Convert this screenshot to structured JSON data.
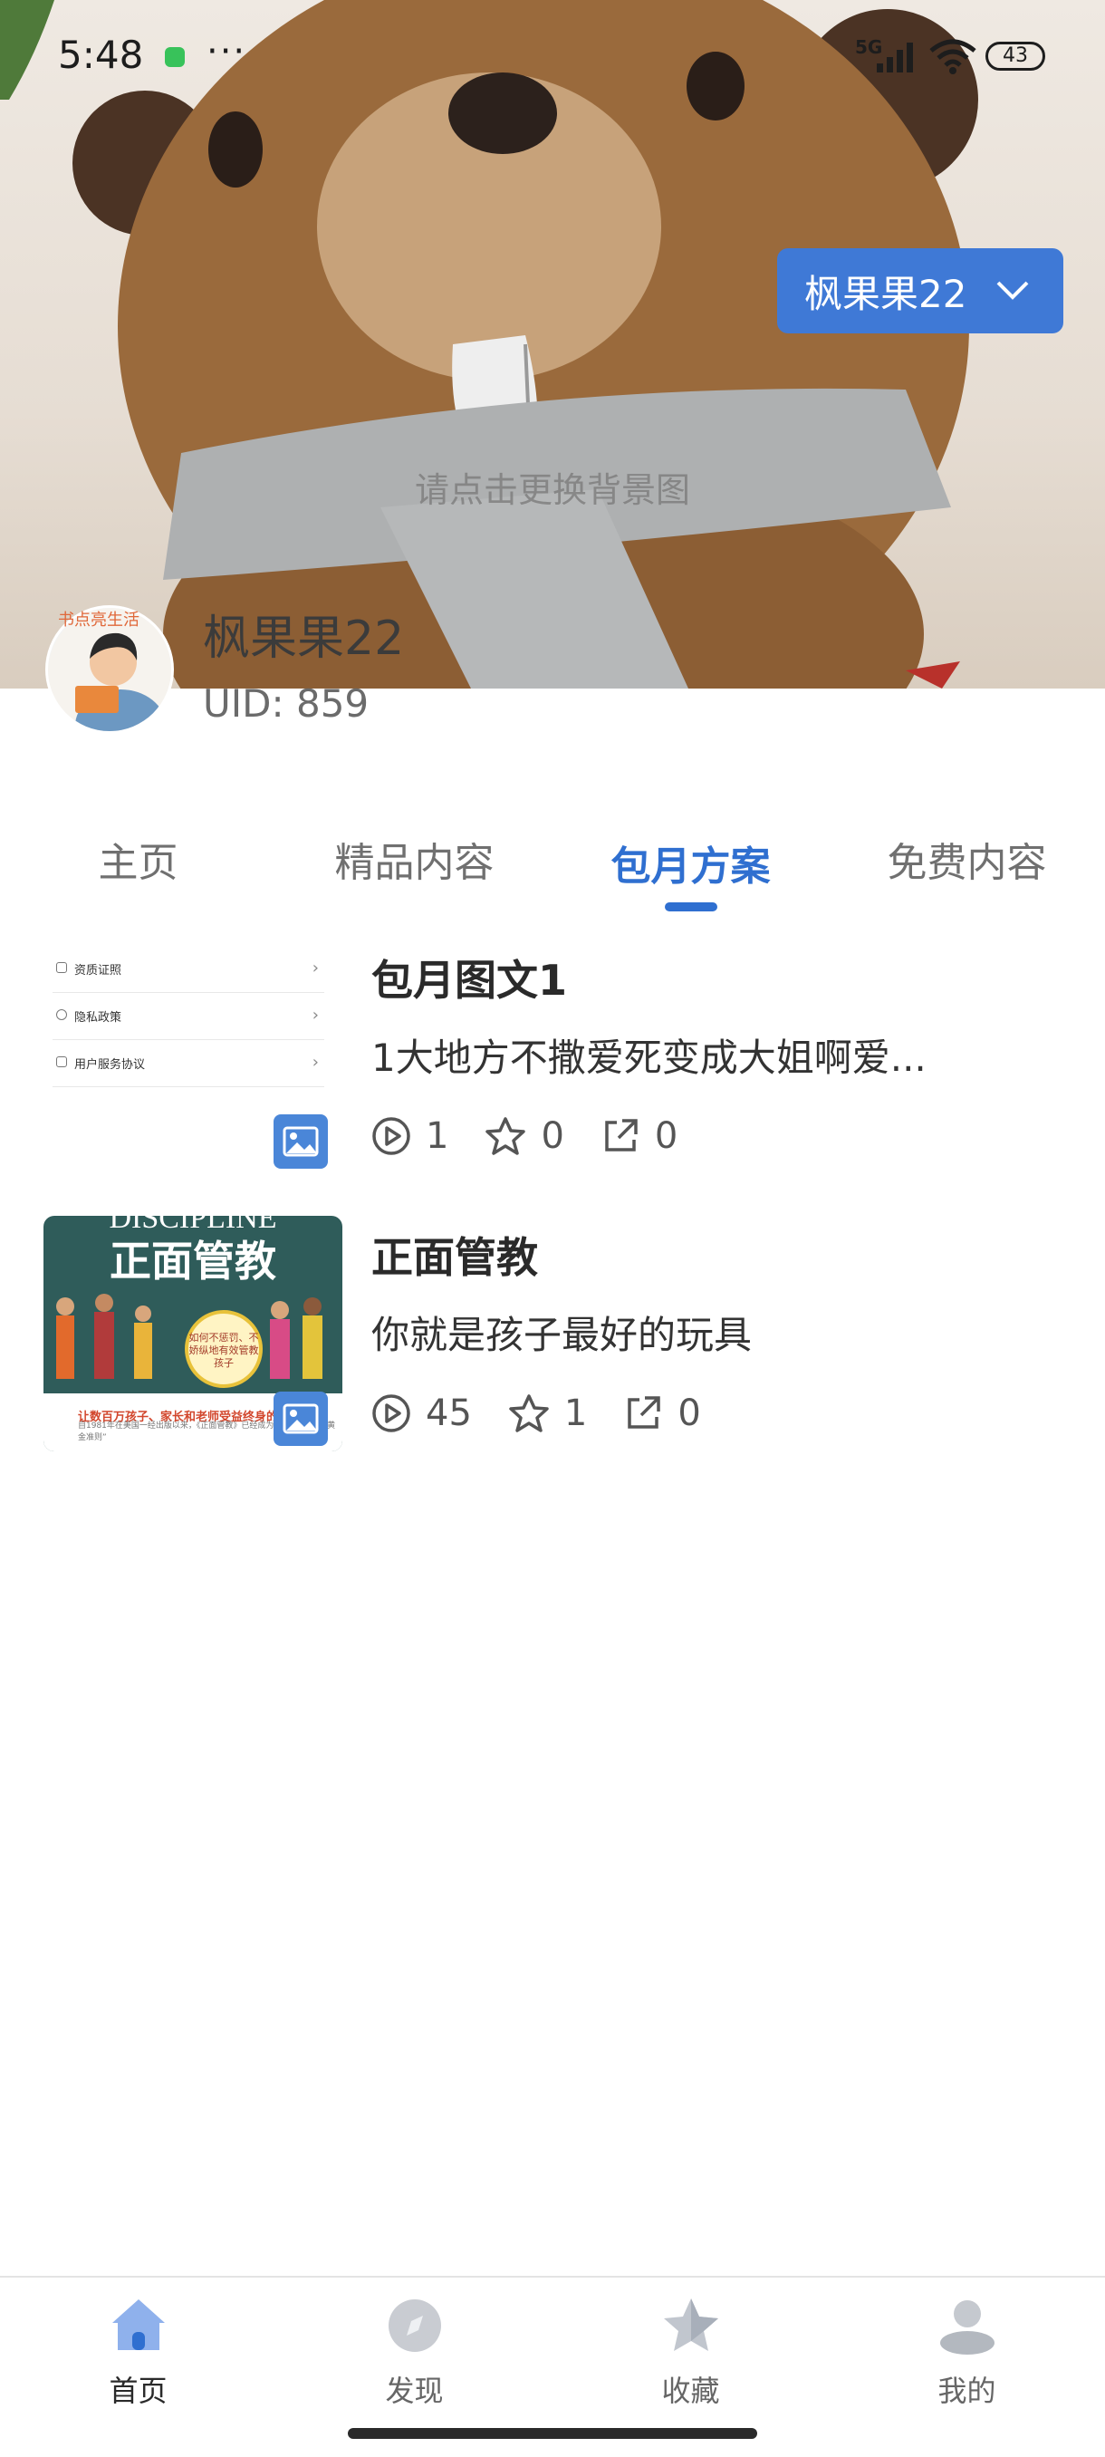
{
  "status_bar": {
    "time": "5:48",
    "more": "···",
    "network": "5G",
    "battery": "43"
  },
  "cover": {
    "hint": "请点击更换背景图"
  },
  "account_switcher": {
    "label": "枫果果22"
  },
  "profile": {
    "avatar_tag": "书点亮生活",
    "name": "枫果果22",
    "uid": "UID: 859"
  },
  "tabs": [
    {
      "label": "主页",
      "active": false
    },
    {
      "label": "精品内容",
      "active": false
    },
    {
      "label": "包月方案",
      "active": true
    },
    {
      "label": "免费内容",
      "active": false
    }
  ],
  "items": [
    {
      "title": "包月图文1",
      "description": "1大地方不撒爱死变成大姐啊爱...",
      "views": "1",
      "favorites": "0",
      "shares": "0",
      "thumb_rows": [
        "资质证照",
        "隐私政策",
        "用户服务协议"
      ]
    },
    {
      "title": "正面管教",
      "description": "你就是孩子最好的玩具",
      "views": "45",
      "favorites": "1",
      "shares": "0",
      "book": {
        "top_text": "DISCIPLINE",
        "title": "正面管教",
        "circle_text": "如何不惩罚、不娇纵地有效管教孩子",
        "line1": "让数百万孩子、家长和老师受益终身的经典",
        "line2": "自1981年在美国一经出版以来，《正面管教》已经成为了管教孩子的“黄金准则”"
      }
    }
  ],
  "bottom_nav": [
    {
      "label": "首页",
      "icon": "home-icon",
      "active": true
    },
    {
      "label": "发现",
      "icon": "compass-icon",
      "active": false
    },
    {
      "label": "收藏",
      "icon": "star-icon",
      "active": false
    },
    {
      "label": "我的",
      "icon": "user-icon",
      "active": false
    }
  ],
  "colors": {
    "accent": "#2f6fd0",
    "account_button": "#3f79d6"
  }
}
